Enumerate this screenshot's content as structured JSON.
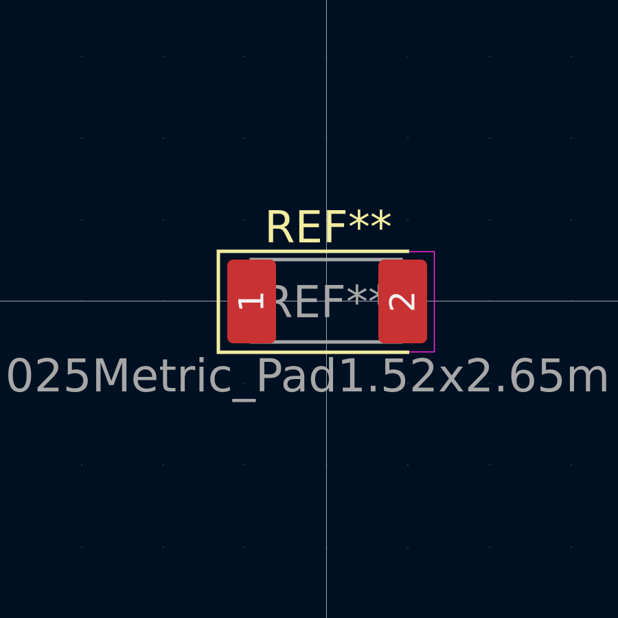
{
  "viewer": {
    "background": "#001023",
    "grid_dot_color": "#33414f",
    "crosshair_color": "#cfd6de"
  },
  "footprint": {
    "silkscreen_reference": "REF**",
    "fab_reference": "REF**",
    "value_text": "025Metric_Pad1.52x2.65m",
    "silkscreen_color": "#f2ec9f",
    "fab_color": "#a7a7a7",
    "pad_color": "#c83232",
    "pad_label_color": "#f2f2f2",
    "courtyard_color": "#ff26e2",
    "pads": [
      {
        "number": "1"
      },
      {
        "number": "2"
      }
    ]
  }
}
